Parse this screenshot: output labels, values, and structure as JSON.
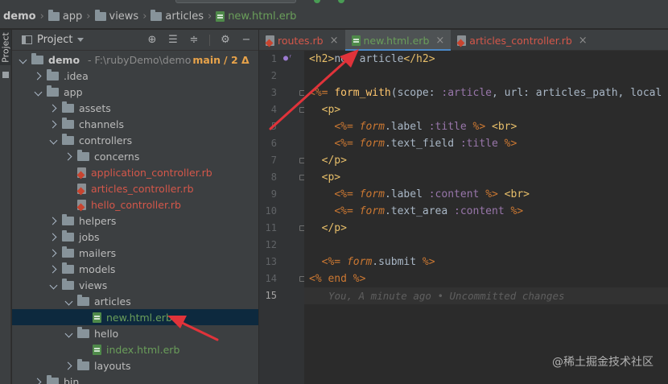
{
  "nav": {
    "crumbs": [
      "demo",
      "app",
      "views",
      "articles",
      "new.html.erb"
    ]
  },
  "project_panel": {
    "title": "Project",
    "side_tab": "Project",
    "tree": [
      {
        "label": "demo",
        "note": "- F:\\rubyDemo\\demo",
        "branch": "main",
        "changes": "/ 2 Δ",
        "depth": 0,
        "arrow": "open",
        "icon": "folder",
        "style": "bold"
      },
      {
        "label": ".idea",
        "depth": 1,
        "arrow": "closed",
        "icon": "folder",
        "style": ""
      },
      {
        "label": "app",
        "depth": 1,
        "arrow": "open",
        "icon": "folder",
        "style": ""
      },
      {
        "label": "assets",
        "depth": 2,
        "arrow": "closed",
        "icon": "folder",
        "style": ""
      },
      {
        "label": "channels",
        "depth": 2,
        "arrow": "closed",
        "icon": "folder",
        "style": ""
      },
      {
        "label": "controllers",
        "depth": 2,
        "arrow": "open",
        "icon": "folder",
        "style": ""
      },
      {
        "label": "concerns",
        "depth": 3,
        "arrow": "closed",
        "icon": "folder",
        "style": ""
      },
      {
        "label": "application_controller.rb",
        "depth": 3,
        "arrow": "none",
        "icon": "rb",
        "style": "red"
      },
      {
        "label": "articles_controller.rb",
        "depth": 3,
        "arrow": "none",
        "icon": "rb",
        "style": "red"
      },
      {
        "label": "hello_controller.rb",
        "depth": 3,
        "arrow": "none",
        "icon": "rb",
        "style": "red"
      },
      {
        "label": "helpers",
        "depth": 2,
        "arrow": "closed",
        "icon": "folder",
        "style": ""
      },
      {
        "label": "jobs",
        "depth": 2,
        "arrow": "closed",
        "icon": "folder",
        "style": ""
      },
      {
        "label": "mailers",
        "depth": 2,
        "arrow": "closed",
        "icon": "folder",
        "style": ""
      },
      {
        "label": "models",
        "depth": 2,
        "arrow": "closed",
        "icon": "folder",
        "style": ""
      },
      {
        "label": "views",
        "depth": 2,
        "arrow": "open",
        "icon": "folder",
        "style": ""
      },
      {
        "label": "articles",
        "depth": 3,
        "arrow": "open",
        "icon": "folder",
        "style": ""
      },
      {
        "label": "new.html.erb",
        "depth": 4,
        "arrow": "none",
        "icon": "erb",
        "style": "green",
        "selected": true
      },
      {
        "label": "hello",
        "depth": 3,
        "arrow": "open",
        "icon": "folder",
        "style": ""
      },
      {
        "label": "index.html.erb",
        "depth": 4,
        "arrow": "none",
        "icon": "erb",
        "style": "green"
      },
      {
        "label": "layouts",
        "depth": 3,
        "arrow": "closed",
        "icon": "folder",
        "style": ""
      },
      {
        "label": "bin",
        "depth": 1,
        "arrow": "closed",
        "icon": "folder",
        "style": ""
      }
    ]
  },
  "editor": {
    "tabs": [
      {
        "label": "routes.rb",
        "kind": "rb",
        "active": false
      },
      {
        "label": "new.html.erb",
        "kind": "erb",
        "active": true
      },
      {
        "label": "articles_controller.rb",
        "kind": "rb",
        "active": false
      }
    ],
    "line_numbers": [
      "1",
      "2",
      "3",
      "4",
      "5",
      "6",
      "7",
      "8",
      "9",
      "10",
      "11",
      "12",
      "13",
      "14",
      "15"
    ],
    "current_line": 15,
    "blame": "You, A minute ago • Uncommitted changes"
  },
  "watermark": "@稀土掘金技术社区",
  "colors": {
    "accent": "#4a88c7",
    "modified_file": "#d4574a",
    "added_file": "#6a9e5a",
    "annotation": "#e0333a"
  }
}
